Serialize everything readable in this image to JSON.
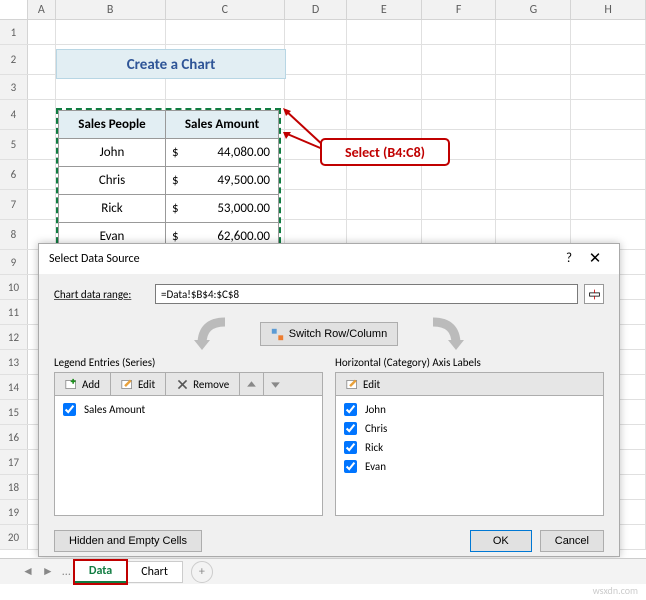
{
  "columns": [
    "A",
    "B",
    "C",
    "D",
    "E",
    "F",
    "G",
    "H"
  ],
  "row_numbers": [
    1,
    2,
    3,
    4,
    5,
    6,
    7,
    8,
    9,
    10,
    11,
    12,
    13,
    14,
    15,
    16,
    17,
    18,
    19,
    20
  ],
  "banner": "Create a Chart",
  "table": {
    "headers": [
      "Sales People",
      "Sales Amount"
    ],
    "rows": [
      {
        "name": "John",
        "amount": "44,080.00"
      },
      {
        "name": "Chris",
        "amount": "49,500.00"
      },
      {
        "name": "Rick",
        "amount": "53,000.00"
      },
      {
        "name": "Evan",
        "amount": "62,600.00"
      }
    ],
    "currency": "$"
  },
  "callout": "Select (B4:C8)",
  "dialog": {
    "title": "Select Data Source",
    "help": "?",
    "close": "✕",
    "range_label": "Chart data range:",
    "range_value": "=Data!$B$4:$C$8",
    "switch_label": "Switch Row/Column",
    "legend_label": "Legend Entries (Series)",
    "add_label": "Add",
    "edit_label": "Edit",
    "remove_label": "Remove",
    "series": [
      {
        "label": "Sales Amount",
        "checked": true
      }
    ],
    "axis_label": "Horizontal (Category) Axis Labels",
    "axis_edit": "Edit",
    "categories": [
      {
        "label": "John",
        "checked": true
      },
      {
        "label": "Chris",
        "checked": true
      },
      {
        "label": "Rick",
        "checked": true
      },
      {
        "label": "Evan",
        "checked": true
      }
    ],
    "hidden_btn": "Hidden and Empty Cells",
    "ok": "OK",
    "cancel": "Cancel"
  },
  "tabs": {
    "ellipsis": "...",
    "items": [
      {
        "label": "Data",
        "active": true
      },
      {
        "label": "Chart",
        "active": false
      }
    ],
    "add": "+"
  },
  "watermark": "wsxdn.com",
  "chart_data": {
    "type": "bar",
    "categories": [
      "John",
      "Chris",
      "Rick",
      "Evan"
    ],
    "series": [
      {
        "name": "Sales Amount",
        "values": [
          44080.0,
          49500.0,
          53000.0,
          62600.0
        ]
      }
    ],
    "title": "",
    "xlabel": "",
    "ylabel": ""
  }
}
